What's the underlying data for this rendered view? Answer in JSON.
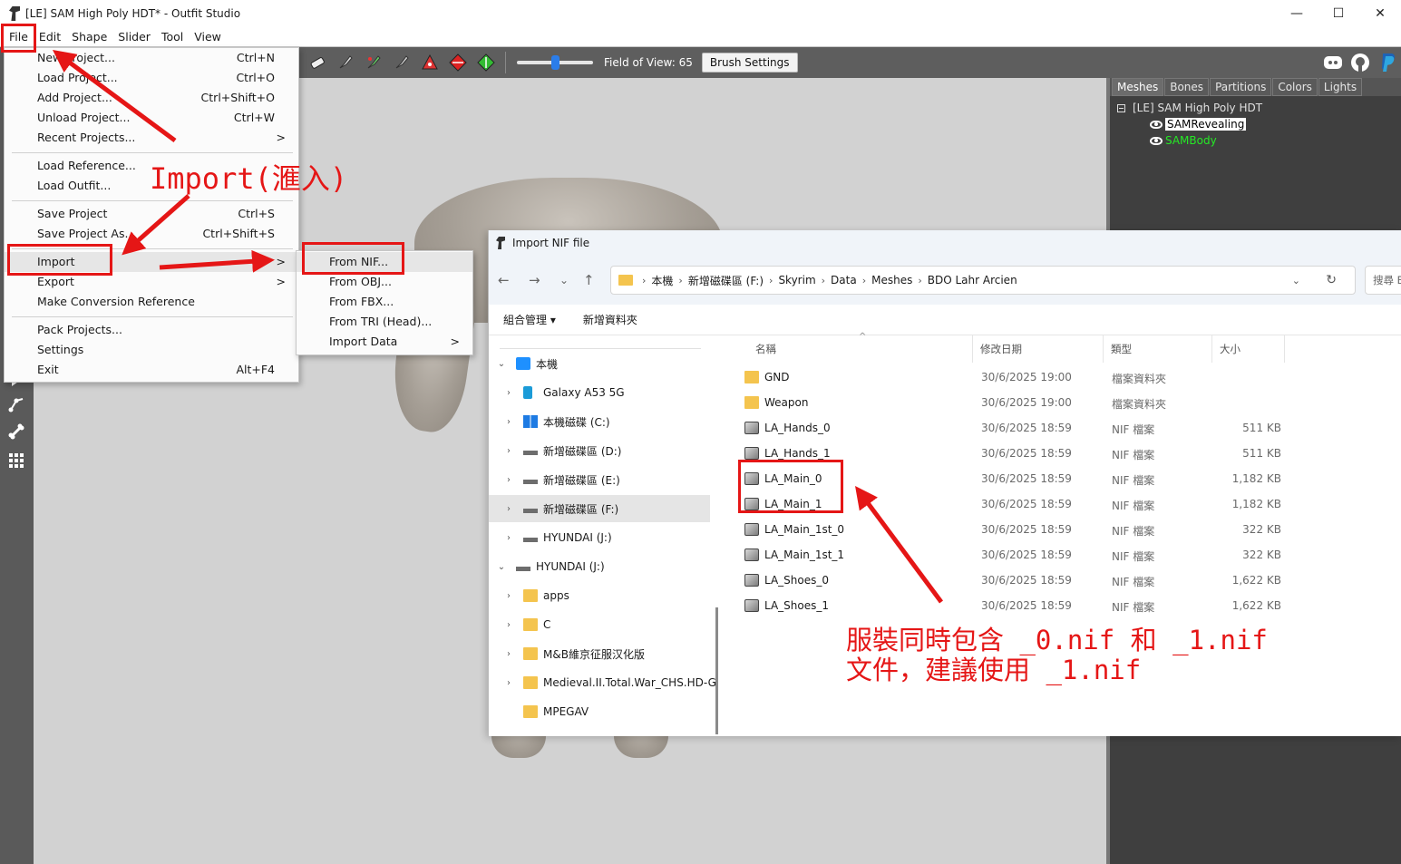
{
  "window": {
    "title": "[LE] SAM High Poly HDT* - Outfit Studio",
    "minimize": "—",
    "maximize": "☐",
    "close": "✕"
  },
  "menubar": [
    "File",
    "Edit",
    "Shape",
    "Slider",
    "Tool",
    "View"
  ],
  "toolbar": {
    "fov_label": "Field of View: 65",
    "fov_value": 65,
    "brush_settings": "Brush Settings"
  },
  "file_menu": {
    "items": [
      {
        "label": "New Project...",
        "shortcut": "Ctrl+N"
      },
      {
        "label": "Load Project...",
        "shortcut": "Ctrl+O"
      },
      {
        "label": "Add Project...",
        "shortcut": "Ctrl+Shift+O"
      },
      {
        "label": "Unload Project...",
        "shortcut": "Ctrl+W"
      },
      {
        "label": "Recent Projects...",
        "shortcut": "",
        "arrow": ">"
      },
      {
        "label": "Load Reference...",
        "shortcut": ""
      },
      {
        "label": "Load Outfit...",
        "shortcut": ""
      },
      {
        "label": "Save Project",
        "shortcut": "Ctrl+S"
      },
      {
        "label": "Save Project As...",
        "shortcut": "Ctrl+Shift+S"
      },
      {
        "label": "Import",
        "shortcut": "",
        "arrow": ">"
      },
      {
        "label": "Export",
        "shortcut": "",
        "arrow": ">"
      },
      {
        "label": "Make Conversion Reference",
        "shortcut": ""
      },
      {
        "label": "Pack Projects...",
        "shortcut": ""
      },
      {
        "label": "Settings",
        "shortcut": ""
      },
      {
        "label": "Exit",
        "shortcut": "Alt+F4"
      }
    ]
  },
  "import_submenu": {
    "items": [
      {
        "label": "From NIF..."
      },
      {
        "label": "From OBJ..."
      },
      {
        "label": "From FBX..."
      },
      {
        "label": "From TRI (Head)..."
      },
      {
        "label": "Import Data",
        "arrow": ">"
      }
    ]
  },
  "right_panel": {
    "tabs": [
      "Meshes",
      "Bones",
      "Partitions",
      "Colors",
      "Lights"
    ],
    "tree": {
      "root": "[LE] SAM High Poly HDT",
      "children": [
        "SAMRevealing",
        "SAMBody"
      ]
    }
  },
  "dialog": {
    "title": "Import NIF file",
    "breadcrumb": [
      "本機",
      "新增磁碟區 (F:)",
      "Skyrim",
      "Data",
      "Meshes",
      "BDO Lahr Arcien"
    ],
    "search_placeholder": "搜尋 BD",
    "commands": {
      "organize": "組合管理 ▾",
      "new_folder": "新增資料夾"
    },
    "columns": {
      "name": "名稱",
      "date": "修改日期",
      "type": "類型",
      "size": "大小"
    },
    "nav": [
      {
        "label": "本機",
        "chev": "⌄",
        "icon": "pc",
        "level": 0
      },
      {
        "label": "Galaxy A53 5G",
        "chev": "›",
        "icon": "phone",
        "level": 1
      },
      {
        "label": "本機磁碟 (C:)",
        "chev": "›",
        "icon": "win",
        "level": 1
      },
      {
        "label": "新增磁碟區 (D:)",
        "chev": "›",
        "icon": "drive",
        "level": 1
      },
      {
        "label": "新增磁碟區 (E:)",
        "chev": "›",
        "icon": "drive",
        "level": 1
      },
      {
        "label": "新增磁碟區 (F:)",
        "chev": "›",
        "icon": "drive",
        "level": 1,
        "selected": true
      },
      {
        "label": "HYUNDAI (J:)",
        "chev": "›",
        "icon": "drive",
        "level": 1
      },
      {
        "label": "HYUNDAI (J:)",
        "chev": "⌄",
        "icon": "drive",
        "level": 0
      },
      {
        "label": "apps",
        "chev": "›",
        "icon": "folder",
        "level": 1
      },
      {
        "label": "C",
        "chev": "›",
        "icon": "folder",
        "level": 1
      },
      {
        "label": "M&B維京征服汉化版",
        "chev": "›",
        "icon": "folder",
        "level": 1
      },
      {
        "label": "Medieval.II.Total.War_CHS.HD-G",
        "chev": "›",
        "icon": "folder",
        "level": 1
      },
      {
        "label": "MPEGAV",
        "chev": "",
        "icon": "folder",
        "level": 1
      }
    ],
    "files": [
      {
        "name": "GND",
        "date": "30/6/2025 19:00",
        "type": "檔案資料夾",
        "size": "",
        "icon": "folder"
      },
      {
        "name": "Weapon",
        "date": "30/6/2025 19:00",
        "type": "檔案資料夾",
        "size": "",
        "icon": "folder"
      },
      {
        "name": "LA_Hands_0",
        "date": "30/6/2025 18:59",
        "type": "NIF 檔案",
        "size": "511 KB",
        "icon": "nif"
      },
      {
        "name": "LA_Hands_1",
        "date": "30/6/2025 18:59",
        "type": "NIF 檔案",
        "size": "511 KB",
        "icon": "nif"
      },
      {
        "name": "LA_Main_0",
        "date": "30/6/2025 18:59",
        "type": "NIF 檔案",
        "size": "1,182 KB",
        "icon": "nif"
      },
      {
        "name": "LA_Main_1",
        "date": "30/6/2025 18:59",
        "type": "NIF 檔案",
        "size": "1,182 KB",
        "icon": "nif"
      },
      {
        "name": "LA_Main_1st_0",
        "date": "30/6/2025 18:59",
        "type": "NIF 檔案",
        "size": "322 KB",
        "icon": "nif"
      },
      {
        "name": "LA_Main_1st_1",
        "date": "30/6/2025 18:59",
        "type": "NIF 檔案",
        "size": "322 KB",
        "icon": "nif"
      },
      {
        "name": "LA_Shoes_0",
        "date": "30/6/2025 18:59",
        "type": "NIF 檔案",
        "size": "1,622 KB",
        "icon": "nif"
      },
      {
        "name": "LA_Shoes_1",
        "date": "30/6/2025 18:59",
        "type": "NIF 檔案",
        "size": "1,622 KB",
        "icon": "nif"
      }
    ]
  },
  "annotations": {
    "import_label": "Import(滙入)",
    "note_line1": "服裝同時包含 _0.nif 和 _1.nif",
    "note_line2": "文件，建議使用 _1.nif",
    "color": "#e51616"
  }
}
